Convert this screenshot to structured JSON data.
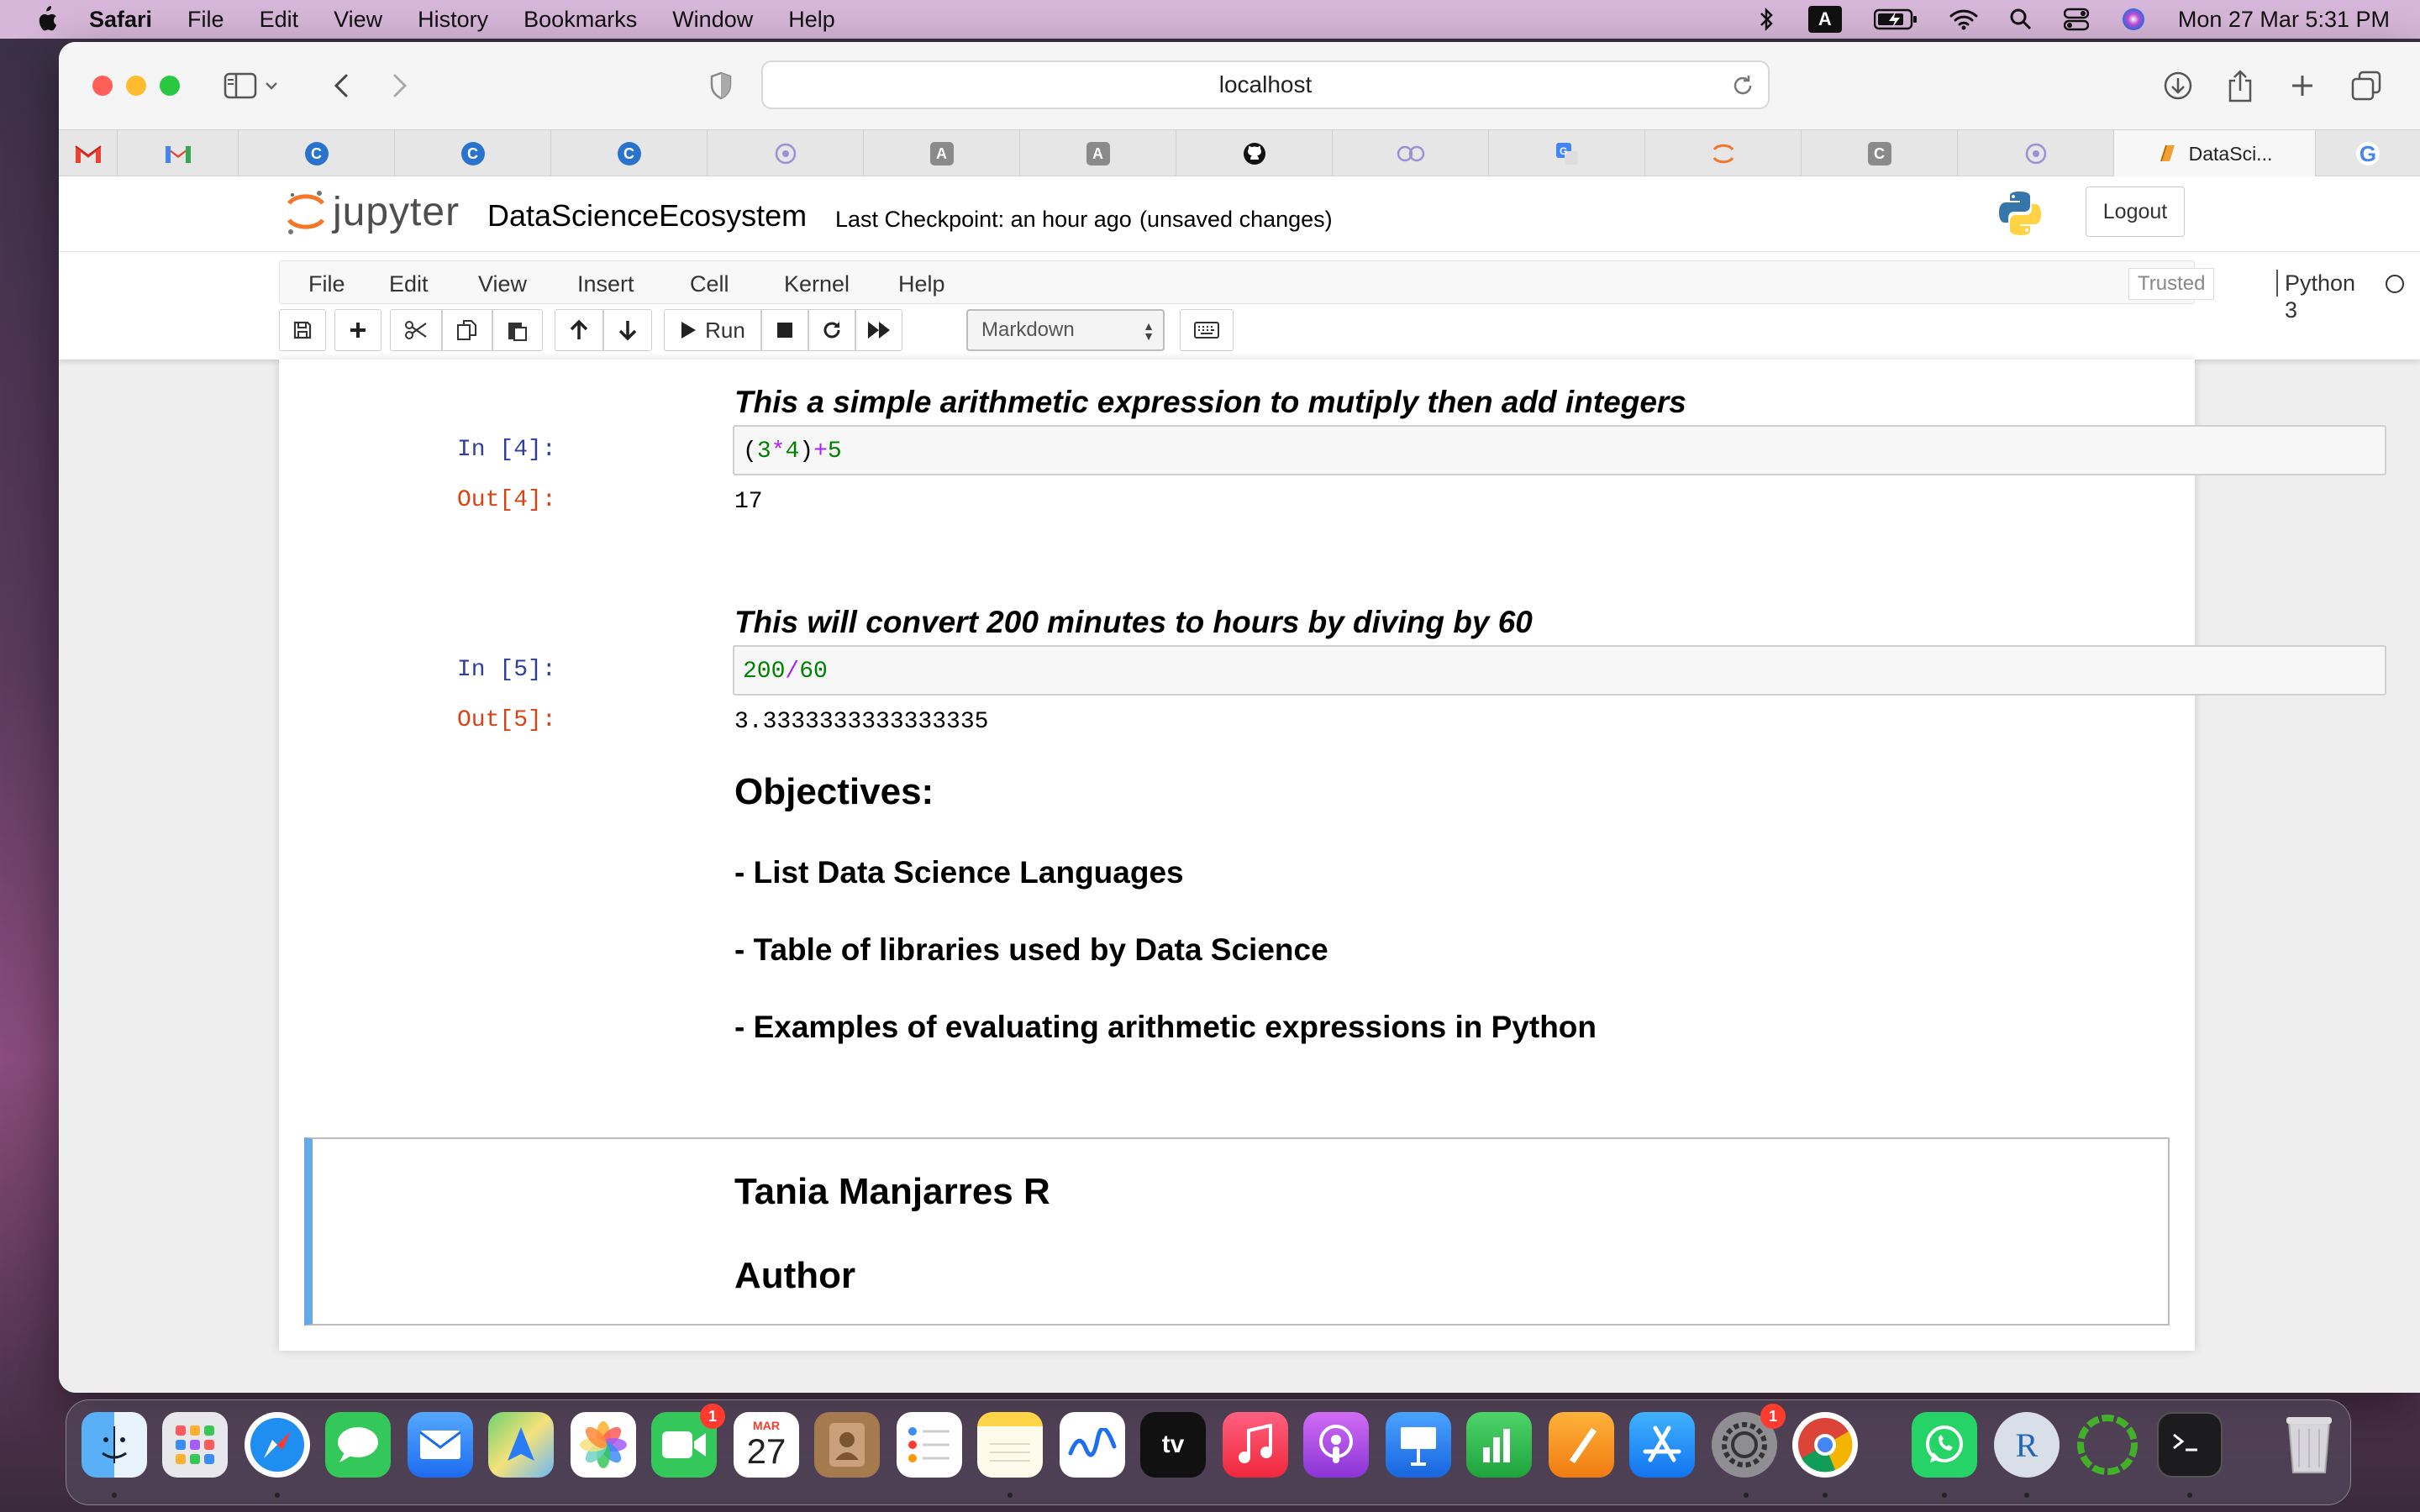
{
  "menubar": {
    "app": "Safari",
    "items": [
      "File",
      "Edit",
      "View",
      "History",
      "Bookmarks",
      "Window",
      "Help"
    ],
    "status_a_label": "A",
    "clock": "Mon 27 Mar  5:31 PM"
  },
  "safari": {
    "url": "localhost",
    "tabs": [
      {
        "icon": "gmail-icon",
        "label": ""
      },
      {
        "icon": "gmail-icon",
        "label": ""
      },
      {
        "icon": "coursera-icon",
        "label": ""
      },
      {
        "icon": "coursera-icon",
        "label": ""
      },
      {
        "icon": "coursera-icon",
        "label": ""
      },
      {
        "icon": "openai-icon",
        "label": ""
      },
      {
        "icon": "a-icon",
        "label": ""
      },
      {
        "icon": "a-icon",
        "label": ""
      },
      {
        "icon": "github-icon",
        "label": ""
      },
      {
        "icon": "ibm-icon",
        "label": ""
      },
      {
        "icon": "translate-icon",
        "label": ""
      },
      {
        "icon": "jupyter-icon",
        "label": ""
      },
      {
        "icon": "c-icon",
        "label": ""
      },
      {
        "icon": "openai-icon",
        "label": ""
      },
      {
        "icon": "notebook-icon",
        "label": "DataSci..."
      },
      {
        "icon": "google-icon",
        "label": ""
      }
    ],
    "tab_active_label": "DataSci...",
    "tab_a_label": "A",
    "tab_c_label": "C",
    "tab_google_label": "G"
  },
  "jupyter": {
    "logo_text": "jupyter",
    "notebook_title": "DataScienceEcosystem",
    "checkpoint": "Last Checkpoint: an hour ago",
    "unsaved": "(unsaved changes)",
    "logout": "Logout",
    "menu": [
      "File",
      "Edit",
      "View",
      "Insert",
      "Cell",
      "Kernel",
      "Help"
    ],
    "trusted": "Trusted",
    "kernel": "Python 3",
    "run_label": "Run",
    "cell_type": "Markdown"
  },
  "notebook": {
    "md1": "This a simple arithmetic expression to mutiply then add integers",
    "in4_prompt": "In [4]:",
    "in4_code": {
      "lp": "(",
      "a": "3",
      "op1": "*",
      "b": "4",
      "rp": ")",
      "op2": "+",
      "c": "5"
    },
    "out4_prompt": "Out[4]:",
    "out4": "17",
    "md2": "This will convert 200 minutes to hours by diving by 60",
    "in5_prompt": "In [5]:",
    "in5_code": {
      "a": "200",
      "op": "/",
      "b": "60"
    },
    "out5_prompt": "Out[5]:",
    "out5": "3.3333333333333335",
    "objectives_heading": "Objectives:",
    "objectives": [
      "- List Data Science Languages",
      "- Table of libraries used by Data Science",
      "- Examples of evaluating arithmetic expressions in Python"
    ],
    "author_name": "Tania Manjarres R",
    "author_label": "Author"
  },
  "dock": {
    "apps": [
      "finder",
      "launchpad",
      "safari",
      "messages",
      "mail",
      "maps",
      "photos",
      "facetime",
      "calendar",
      "contacts",
      "reminders",
      "notes",
      "freeform",
      "tv",
      "music",
      "podcasts",
      "keynote",
      "numbers",
      "pages",
      "app-store",
      "system-settings",
      "chrome",
      "whatsapp",
      "r",
      "anaconda",
      "terminal",
      "trash"
    ],
    "facetime_badge": "1",
    "settings_badge": "1",
    "calendar_month": "MAR",
    "calendar_day": "27",
    "tv_label": "tv",
    "r_label": "R"
  },
  "colors": {
    "menubar_bg": "#d7b7d9",
    "selected_cell_border": "#66a9e8",
    "in_prompt": "#303f9f",
    "out_prompt": "#d84315",
    "jupyter_orange": "#f37726"
  }
}
